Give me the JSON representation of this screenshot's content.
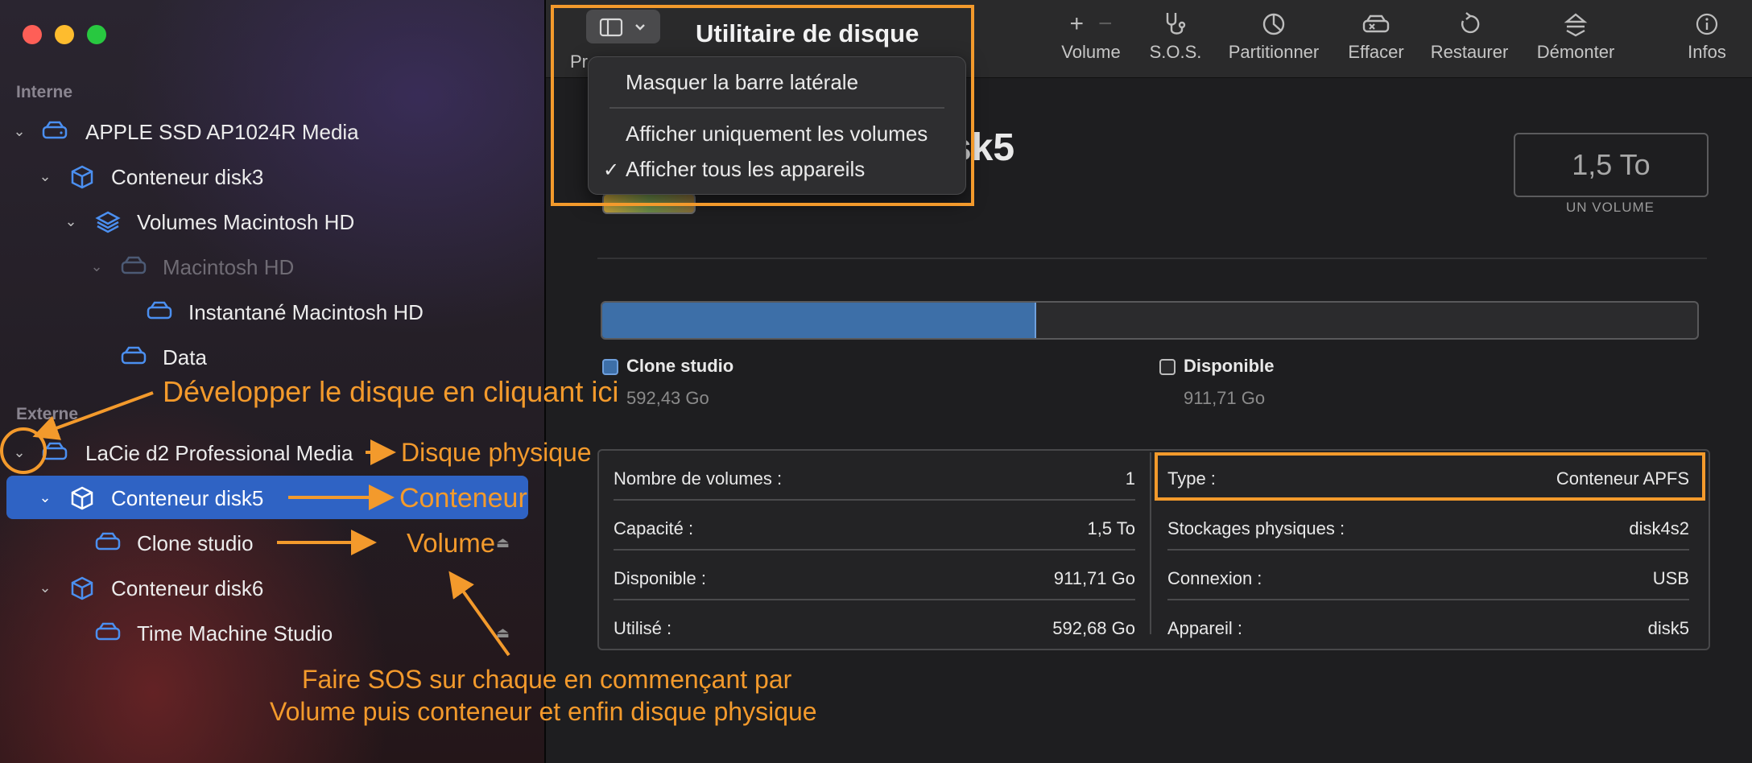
{
  "window": {
    "title": "Utilitaire de disque"
  },
  "sidebar": {
    "section_internal": "Interne",
    "section_external": "Externe",
    "items": [
      {
        "label": "APPLE SSD AP1024R Media",
        "icon": "drive-icon"
      },
      {
        "label": "Conteneur disk3",
        "icon": "container-icon"
      },
      {
        "label": "Volumes Macintosh HD",
        "icon": "layers-icon"
      },
      {
        "label": "Macintosh HD",
        "icon": "drive-icon"
      },
      {
        "label": "Instantané Macintosh HD",
        "icon": "drive-icon"
      },
      {
        "label": "Data",
        "icon": "drive-icon"
      },
      {
        "label": "LaCie d2 Professional Media",
        "icon": "drive-icon"
      },
      {
        "label": "Conteneur disk5",
        "icon": "container-icon"
      },
      {
        "label": "Clone studio",
        "icon": "drive-icon"
      },
      {
        "label": "Conteneur disk6",
        "icon": "container-icon"
      },
      {
        "label": "Time Machine Studio",
        "icon": "drive-icon"
      }
    ]
  },
  "toolbar": {
    "partial_label": "Pr",
    "buttons": [
      {
        "label": "Volume",
        "icon": "plus-minus-icon"
      },
      {
        "label": "S.O.S.",
        "icon": "stethoscope-icon"
      },
      {
        "label": "Partitionner",
        "icon": "pie-icon"
      },
      {
        "label": "Effacer",
        "icon": "erase-icon"
      },
      {
        "label": "Restaurer",
        "icon": "restore-icon"
      },
      {
        "label": "Démonter",
        "icon": "unmount-icon"
      },
      {
        "label": "Infos",
        "icon": "info-icon"
      }
    ]
  },
  "menu": {
    "items": [
      {
        "label": "Masquer la barre latérale",
        "checked": false
      },
      {
        "label": "Afficher uniquement les volumes",
        "checked": false
      },
      {
        "label": "Afficher tous les appareils",
        "checked": true
      }
    ],
    "check_glyph": "✓"
  },
  "main": {
    "title_visible": "sk5",
    "capacity": "1,5 To",
    "capacity_caption": "UN VOLUME",
    "usage_fraction": 0.395,
    "legend": [
      {
        "name": "Clone studio",
        "value": "592,43 Go",
        "color": "#3d6fa8"
      },
      {
        "name": "Disponible",
        "value": "911,71 Go",
        "color": "#2b2b2d"
      }
    ],
    "info_left": [
      {
        "key": "Nombre de volumes :",
        "value": "1"
      },
      {
        "key": "Capacité :",
        "value": "1,5 To"
      },
      {
        "key": "Disponible :",
        "value": "911,71 Go"
      },
      {
        "key": "Utilisé :",
        "value": "592,68 Go"
      }
    ],
    "info_right": [
      {
        "key": "Type :",
        "value": "Conteneur APFS"
      },
      {
        "key": "Stockages physiques :",
        "value": "disk4s2"
      },
      {
        "key": "Connexion :",
        "value": "USB"
      },
      {
        "key": "Appareil :",
        "value": "disk5"
      }
    ]
  },
  "annotations": {
    "expand_hint": "Développer le disque en cliquant ici",
    "physical_disk": "Disque physique",
    "container": "Conteneur",
    "volume": "Volume",
    "sos_line1": "Faire SOS sur chaque en commençant par",
    "sos_line2": "Volume puis conteneur et enfin disque physique",
    "color": "#f39a2c"
  }
}
